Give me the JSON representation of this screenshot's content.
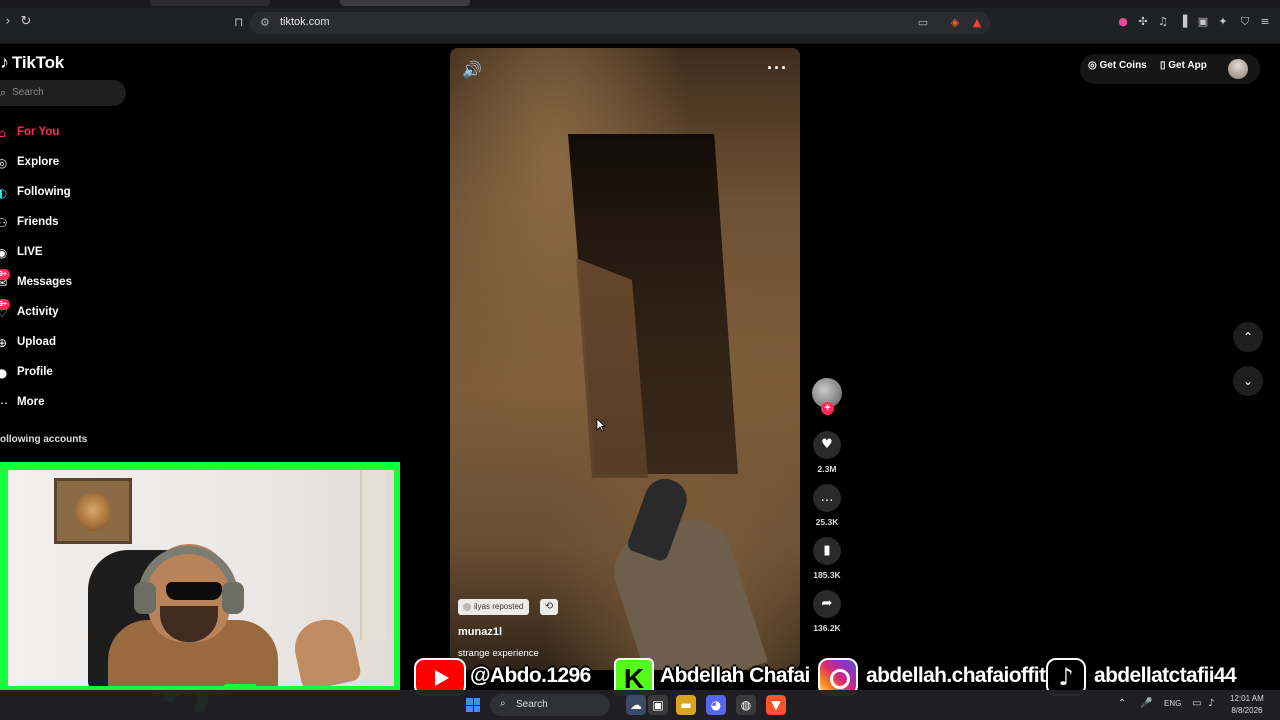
{
  "browser": {
    "url": "tiktok.com",
    "icons": {
      "back": "chevron-right",
      "reload": "reload",
      "bookmark": "bookmark",
      "site_info": "site-settings",
      "cast": "cast",
      "shield": "brave-shield",
      "rewards": "brave-rewards"
    }
  },
  "sidebar": {
    "logo_text": "TikTok",
    "search_placeholder": "Search",
    "items": [
      {
        "label": "For You",
        "icon": "home-icon",
        "active": true
      },
      {
        "label": "Explore",
        "icon": "compass-icon"
      },
      {
        "label": "Following",
        "icon": "following-icon"
      },
      {
        "label": "Friends",
        "icon": "friends-icon"
      },
      {
        "label": "LIVE",
        "icon": "live-icon"
      },
      {
        "label": "Messages",
        "icon": "messages-icon",
        "badge": "9+"
      },
      {
        "label": "Activity",
        "icon": "activity-icon",
        "badge": "9+"
      },
      {
        "label": "Upload",
        "icon": "upload-icon"
      },
      {
        "label": "Profile",
        "icon": "profile-icon"
      },
      {
        "label": "More",
        "icon": "more-icon"
      }
    ],
    "following_accounts_label": "ollowing accounts"
  },
  "video": {
    "repost_label": "ilyas reposted",
    "author": "munaz1l",
    "description": "strange experience"
  },
  "actions": {
    "likes": "2.3M",
    "comments": "25.3K",
    "saves": "185.3K",
    "shares": "136.2K"
  },
  "header": {
    "get_coins": "Get Coins",
    "get_app": "Get App"
  },
  "banner": {
    "youtube": "@Abdo.1296",
    "kick": "Abdellah Chafai",
    "instagram": "abdellah.chafaioffitid",
    "tiktok": "abdellatctafii44"
  },
  "taskbar": {
    "search": "Search",
    "lang": "ENG",
    "time": "12:01 AM",
    "date": "8/8/2026"
  },
  "colors": {
    "accent": "#fe2c55",
    "webcam_border": "#12ff3a",
    "kick": "#53fc18",
    "youtube": "#ff0000"
  }
}
